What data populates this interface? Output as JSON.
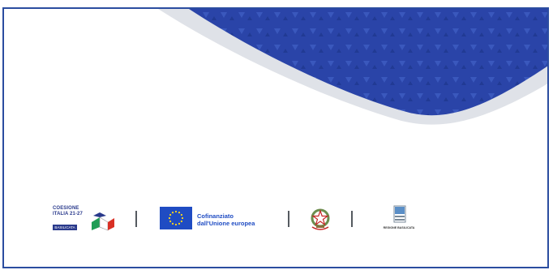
{
  "colors": {
    "frame_border": "#2b4da0",
    "banner_blue": "#2a44a8",
    "banner_shadow": "#d9dde3",
    "eu_blue": "#1f4cc3",
    "eu_star": "#ffd91a",
    "coesione_navy": "#2a3a8c"
  },
  "logos": {
    "coesione": {
      "line1": "COESIONE",
      "line2": "ITALIA 21-27",
      "badge": "BASILICATA"
    },
    "eu": {
      "line1": "Cofinanziato",
      "line2": "dall'Unione europea"
    },
    "regione": {
      "label": "REGIONE BASILICATA"
    }
  },
  "icons": {
    "eu_flag": "eu-flag-icon",
    "emblem": "italian-republic-emblem-icon",
    "regione": "regione-basilicata-icon",
    "coesione_mark": "coesione-3d-mark-icon"
  }
}
